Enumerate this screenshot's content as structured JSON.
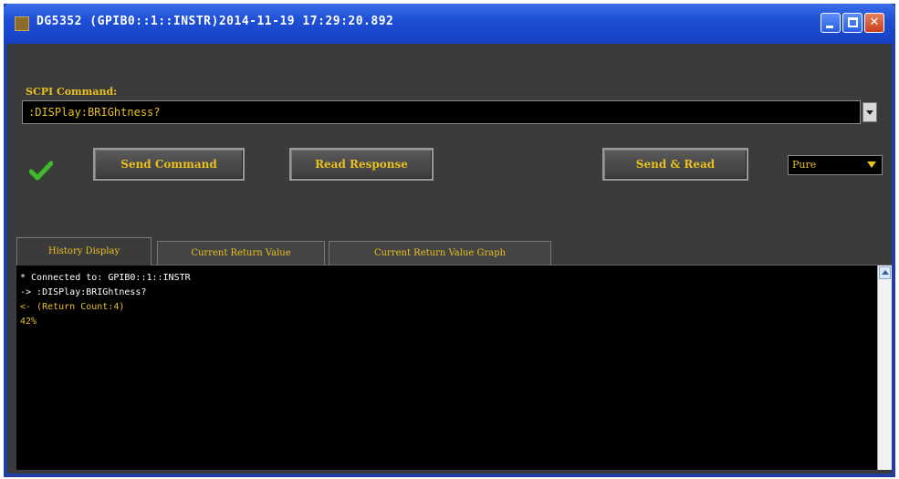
{
  "window": {
    "title": "DG5352 (GPIB0::1::INSTR)2014-11-19 17:29:20.892"
  },
  "scpi": {
    "label": "SCPI Command:",
    "command_value": ":DISPlay:BRIGhtness?"
  },
  "buttons": {
    "send": "Send Command",
    "read": "Read Response",
    "send_read": "Send & Read"
  },
  "format_select": {
    "selected": "Pure"
  },
  "tabs": [
    {
      "label": "History Display",
      "active": true
    },
    {
      "label": "Current Return Value",
      "active": false
    },
    {
      "label": "Current Return Value Graph",
      "active": false
    }
  ],
  "history": {
    "lines": [
      "* Connected to: GPIB0::1::INSTR",
      "-> :DISPlay:BRIGhtness?",
      "<- (Return Count:4)",
      "42%"
    ]
  },
  "colors": {
    "accent": "#e8c020",
    "panel": "#3b3b3b",
    "console": "#000000",
    "titlebar": "#1e4fd6",
    "check": "#3dbb2a"
  },
  "icons": {
    "status": "check-icon"
  }
}
